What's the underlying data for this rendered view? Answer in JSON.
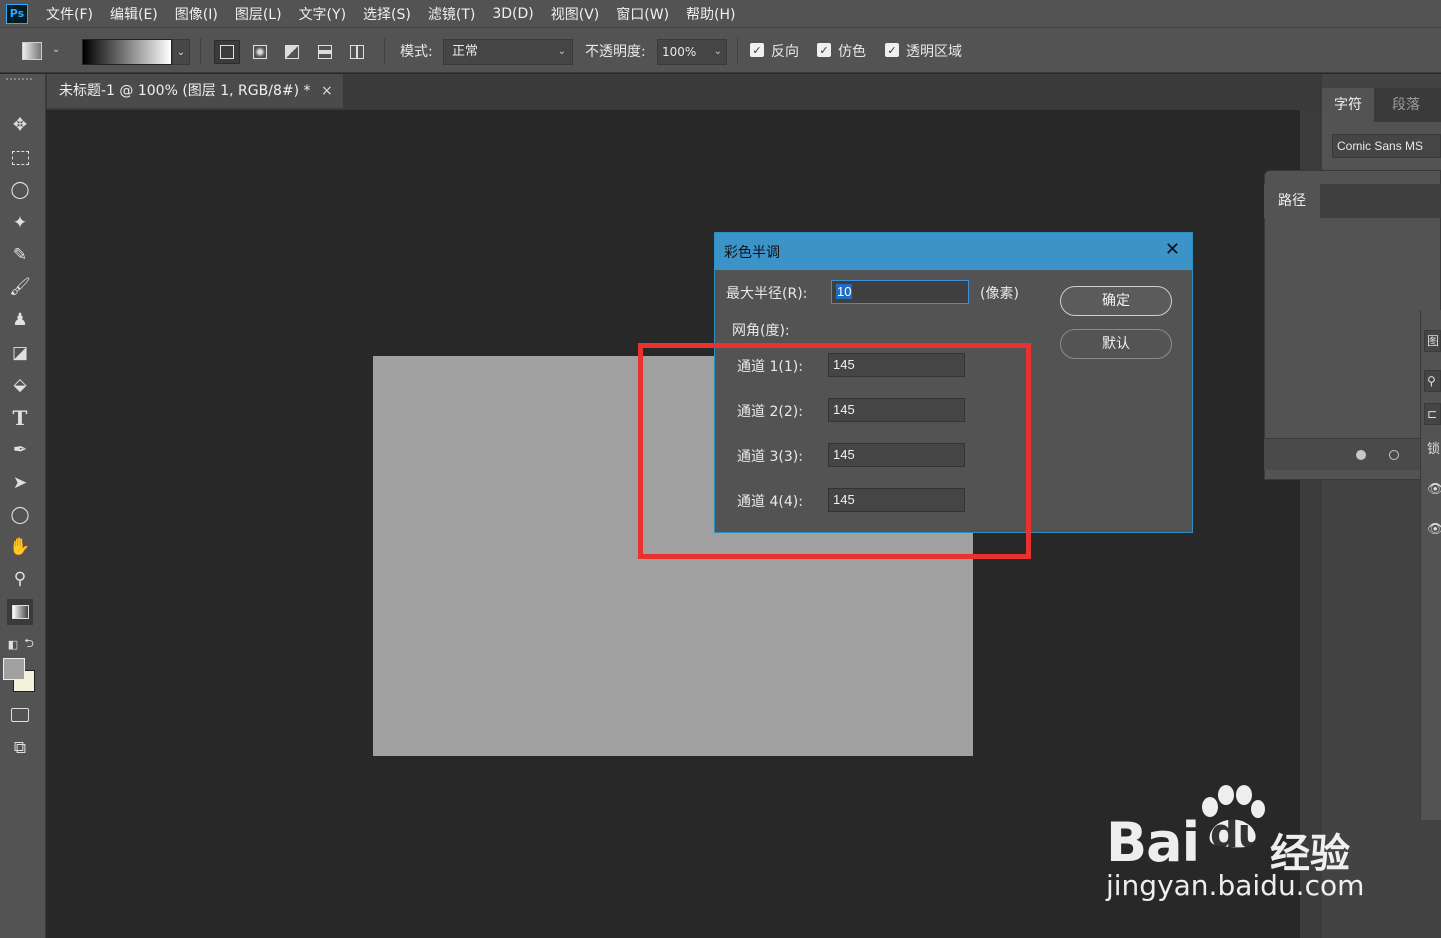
{
  "app": {
    "logo": "Ps"
  },
  "menu": [
    "文件(F)",
    "编辑(E)",
    "图像(I)",
    "图层(L)",
    "文字(Y)",
    "选择(S)",
    "滤镜(T)",
    "3D(D)",
    "视图(V)",
    "窗口(W)",
    "帮助(H)"
  ],
  "options": {
    "mode_label": "模式:",
    "mode_value": "正常",
    "opacity_label": "不透明度:",
    "opacity_value": "100%",
    "reverse_label": "反向",
    "dither_label": "仿色",
    "transparency_label": "透明区域",
    "reverse_checked": true,
    "dither_checked": true,
    "transparency_checked": true
  },
  "document": {
    "tab_title": "未标题-1 @ 100% (图层 1, RGB/8#) *",
    "close": "×"
  },
  "panels": {
    "character_tab": "字符",
    "paragraph_tab": "段落",
    "font_family": "Comic Sans MS",
    "paths_tab": "路径",
    "layers_edge": {
      "tab": "图",
      "lock": "锁"
    }
  },
  "dialog": {
    "title": "彩色半调",
    "close": "✕",
    "max_radius_label": "最大半径(R):",
    "max_radius_value": "10",
    "max_radius_unit": "(像素)",
    "screen_angles_label": "网角(度):",
    "channels": [
      {
        "label": "通道 1(1):",
        "value": "145"
      },
      {
        "label": "通道 2(2):",
        "value": "145"
      },
      {
        "label": "通道 3(3):",
        "value": "145"
      },
      {
        "label": "通道 4(4):",
        "value": "145"
      }
    ],
    "ok_label": "确定",
    "default_label": "默认"
  },
  "watermark": {
    "brand": "Bai",
    "brand_suffix": "du",
    "cn": "经验",
    "url": "jingyan.baidu.com"
  },
  "colors": {
    "accent": "#3c93c7",
    "highlight": "#e8322f",
    "canvas": "#a0a0a0"
  }
}
